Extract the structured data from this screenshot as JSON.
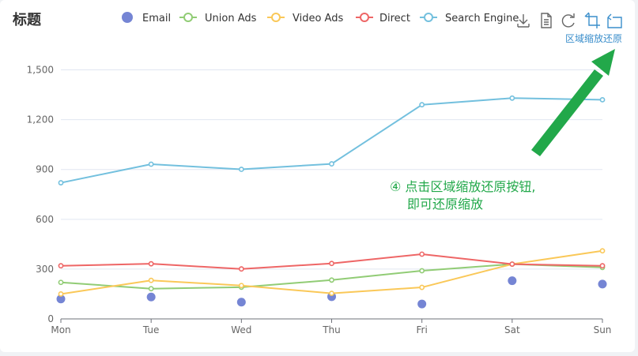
{
  "chart_data": {
    "type": "line",
    "title": "标题",
    "xlabel": "",
    "ylabel": "",
    "categories": [
      "Mon",
      "Tue",
      "Wed",
      "Thu",
      "Fri",
      "Sat",
      "Sun"
    ],
    "ylim": [
      0,
      1650
    ],
    "yticks": [
      0,
      300,
      600,
      900,
      1200,
      1500
    ],
    "ytick_labels": [
      "0",
      "300",
      "600",
      "900",
      "1,200",
      "1,500"
    ],
    "grid": true,
    "legend_position": "top-right",
    "series": [
      {
        "name": "Email",
        "render": "scatter",
        "color": "#7585d4",
        "values": [
          120,
          132,
          101,
          134,
          90,
          230,
          210
        ]
      },
      {
        "name": "Union Ads",
        "render": "line",
        "color": "#91cc75",
        "values": [
          220,
          182,
          191,
          234,
          290,
          330,
          310
        ]
      },
      {
        "name": "Video Ads",
        "render": "line",
        "color": "#fac858",
        "values": [
          150,
          232,
          201,
          154,
          190,
          330,
          410
        ]
      },
      {
        "name": "Direct",
        "render": "line",
        "color": "#ee6666",
        "values": [
          320,
          332,
          301,
          334,
          390,
          330,
          320
        ]
      },
      {
        "name": "Search Engine",
        "render": "line",
        "color": "#73c0de",
        "values": [
          820,
          932,
          901,
          934,
          1290,
          1330,
          1320
        ]
      }
    ]
  },
  "toolbox": {
    "zoom_reset_label": "区域缩放还原",
    "icons": [
      "download-icon",
      "data-view-icon",
      "restore-icon",
      "zoom-icon",
      "zoom-reset-icon"
    ],
    "icon_color": "#3a8ecb"
  },
  "annotation": {
    "line1": "④ 点击区域缩放还原按钮,",
    "line2": "即可还原缩放",
    "color": "#22a84a"
  },
  "colors": {
    "axis": "#6e7079",
    "grid": "#e0e6f1",
    "tick_label": "#6e7079"
  }
}
